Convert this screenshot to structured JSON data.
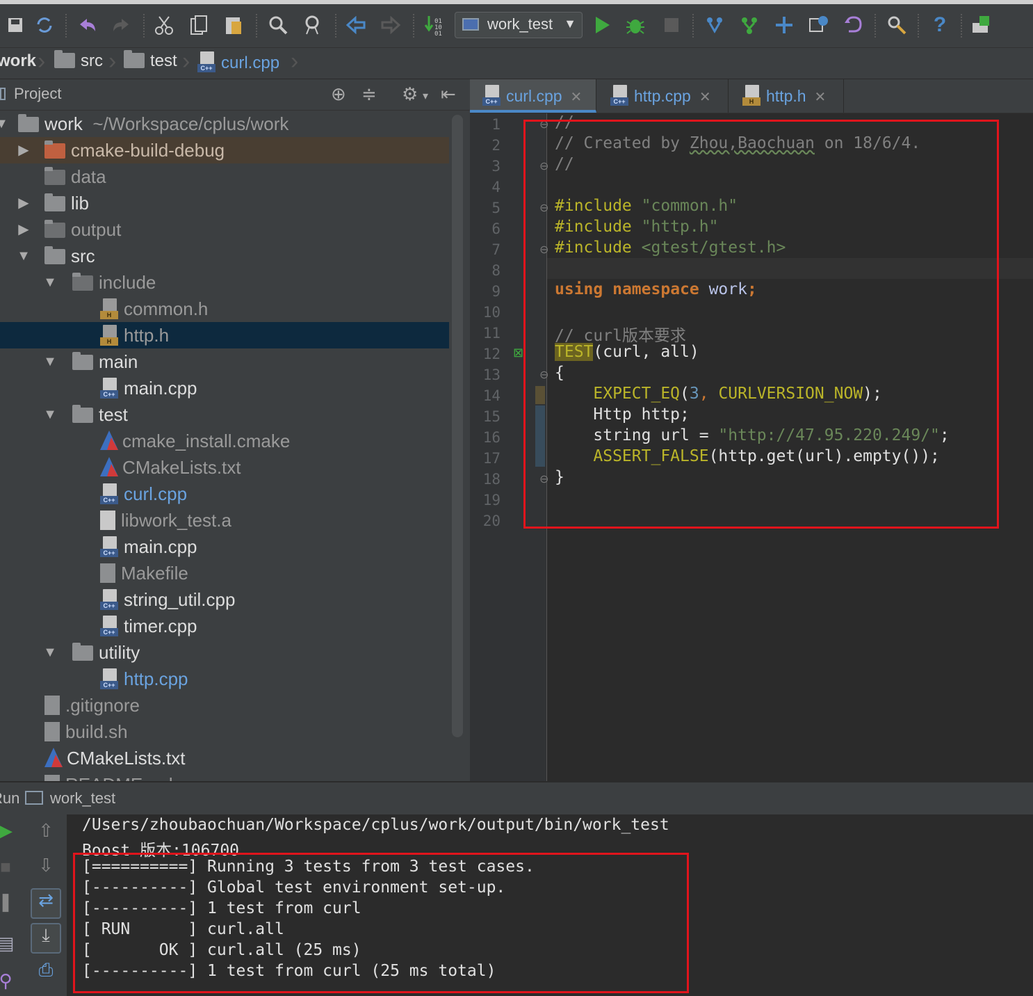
{
  "toolbar": {
    "icons": [
      "save-all-icon",
      "sync-icon",
      "undo-icon",
      "redo-icon",
      "cut-icon",
      "copy-icon",
      "paste-icon",
      "find-icon",
      "replace-icon",
      "back-icon",
      "forward-icon",
      "build-icon",
      "run-icon",
      "debug-icon",
      "stop-icon",
      "vcs-update-icon",
      "vcs-commit-icon",
      "vcs-push-icon",
      "vcs-history-icon",
      "vcs-revert-icon",
      "settings-icon",
      "help-icon",
      "sdk-icon"
    ],
    "run_config": "work_test"
  },
  "breadcrumb": {
    "items": [
      "work",
      "src",
      "test",
      "curl.cpp"
    ]
  },
  "project_panel": {
    "title": "Project",
    "tree": [
      {
        "label": "work",
        "suffix": "~/Workspace/cplus/work",
        "type": "folder",
        "level": 0,
        "expanded": true
      },
      {
        "label": "cmake-build-debug",
        "type": "folder-orange",
        "level": 1,
        "expanded": false
      },
      {
        "label": "data",
        "type": "folder",
        "level": 1,
        "expanded": null
      },
      {
        "label": "lib",
        "type": "folder",
        "level": 1,
        "expanded": false
      },
      {
        "label": "output",
        "type": "folder",
        "level": 1,
        "expanded": false
      },
      {
        "label": "src",
        "type": "folder",
        "level": 1,
        "expanded": true
      },
      {
        "label": "include",
        "type": "folder",
        "level": 2,
        "expanded": true
      },
      {
        "label": "common.h",
        "type": "h",
        "level": 3
      },
      {
        "label": "http.h",
        "type": "h",
        "level": 3,
        "selected": true
      },
      {
        "label": "main",
        "type": "folder",
        "level": 2,
        "expanded": true
      },
      {
        "label": "main.cpp",
        "type": "cpp",
        "level": 3
      },
      {
        "label": "test",
        "type": "folder",
        "level": 2,
        "expanded": true
      },
      {
        "label": "cmake_install.cmake",
        "type": "cmake",
        "level": 3
      },
      {
        "label": "CMakeLists.txt",
        "type": "cmake",
        "level": 3
      },
      {
        "label": "curl.cpp",
        "type": "cpp",
        "level": 3,
        "active": true
      },
      {
        "label": "libwork_test.a",
        "type": "plain",
        "level": 3
      },
      {
        "label": "main.cpp",
        "type": "cpp",
        "level": 3
      },
      {
        "label": "Makefile",
        "type": "text",
        "level": 3
      },
      {
        "label": "string_util.cpp",
        "type": "cpp",
        "level": 3
      },
      {
        "label": "timer.cpp",
        "type": "cpp",
        "level": 3
      },
      {
        "label": "utility",
        "type": "folder",
        "level": 2,
        "expanded": true
      },
      {
        "label": "http.cpp",
        "type": "cpp",
        "level": 3,
        "active": true
      },
      {
        "label": ".gitignore",
        "type": "text",
        "level": 1
      },
      {
        "label": "build.sh",
        "type": "text",
        "level": 1
      },
      {
        "label": "CMakeLists.txt",
        "type": "cmake",
        "level": 1
      },
      {
        "label": "README.md",
        "type": "text",
        "level": 1
      }
    ]
  },
  "editor": {
    "tabs": [
      {
        "label": "curl.cpp",
        "kind": "cpp",
        "active": true
      },
      {
        "label": "http.cpp",
        "kind": "cpp",
        "active": false
      },
      {
        "label": "http.h",
        "kind": "h",
        "active": false
      }
    ],
    "line_numbers": [
      "1",
      "2",
      "3",
      "4",
      "5",
      "6",
      "7",
      "8",
      "9",
      "10",
      "11",
      "12",
      "13",
      "14",
      "15",
      "16",
      "17",
      "18",
      "19",
      "20"
    ],
    "code": {
      "l1": "//",
      "l2_prefix": "// Created by ",
      "l2_author": "Zhou,Baochuan",
      "l2_suffix": " on 18/6/4.",
      "l3": "//",
      "l5_kw": "#include",
      "l5_str": "\"common.h\"",
      "l6_kw": "#include",
      "l6_str": "\"http.h\"",
      "l7_kw": "#include",
      "l7_str": "<gtest/gtest.h>",
      "l9_kw1": "using",
      "l9_kw2": "namespace",
      "l9_rest": " work",
      "l9_semi": ";",
      "l11": "// curl版本要求",
      "l12_macro": "TEST",
      "l12_rest": "(curl, all)",
      "l13": "{",
      "l14_macro": "EXPECT_EQ",
      "l14_open": "(",
      "l14_num": "3",
      "l14_comma": ", ",
      "l14_const": "CURLVERSION_NOW",
      "l14_close": ");",
      "l15_type": "Http",
      "l15_rest": " http;",
      "l16_a": "string url = ",
      "l16_str": "\"http://47.95.220.249/\"",
      "l16_semi": ";",
      "l17_macro": "ASSERT_FALSE",
      "l17_rest": "(http.get(url).empty());",
      "l18": "}"
    }
  },
  "run_panel": {
    "label": "Run",
    "config": "work_test",
    "console": [
      "/Users/zhoubaochuan/Workspace/cplus/work/output/bin/work_test",
      "Boost 版本:106700",
      "[==========] Running 3 tests from 3 test cases.",
      "[----------] Global test environment set-up.",
      "[----------] 1 test from curl",
      "[ RUN      ] curl.all",
      "[       OK ] curl.all (25 ms)",
      "[----------] 1 test from curl (25 ms total)"
    ]
  },
  "colors": {
    "accent_blue": "#4a88c7",
    "highlight_red": "#e0141c",
    "selection": "#0d293e",
    "run_green": "#3fa93f"
  }
}
